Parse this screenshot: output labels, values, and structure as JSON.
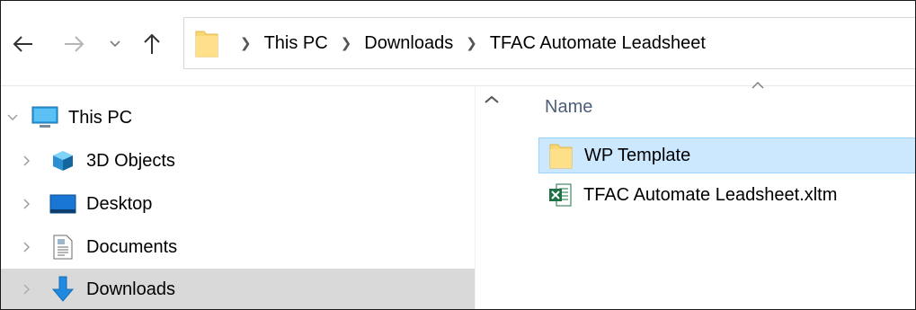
{
  "addressbar": {
    "breadcrumbs": [
      "This PC",
      "Downloads",
      "TFAC Automate Leadsheet"
    ]
  },
  "nav": {
    "items": [
      {
        "label": "This PC",
        "icon": "monitor-icon",
        "expanded": true
      },
      {
        "label": "3D Objects",
        "icon": "3d-objects-icon"
      },
      {
        "label": "Desktop",
        "icon": "desktop-icon"
      },
      {
        "label": "Documents",
        "icon": "documents-icon"
      },
      {
        "label": "Downloads",
        "icon": "download-arrow-icon",
        "selected": true
      }
    ]
  },
  "content": {
    "column_header": "Name",
    "files": [
      {
        "name": "WP Template",
        "type": "folder",
        "selected": true
      },
      {
        "name": "TFAC Automate Leadsheet.xltm",
        "type": "excel-template"
      }
    ]
  },
  "colors": {
    "selection_bg": "#cce8ff",
    "selection_border": "#99d1ff",
    "nav_selected_bg": "#d9d9d9",
    "column_header_text": "#4c607a",
    "folder_yellow": "#f8d775"
  }
}
